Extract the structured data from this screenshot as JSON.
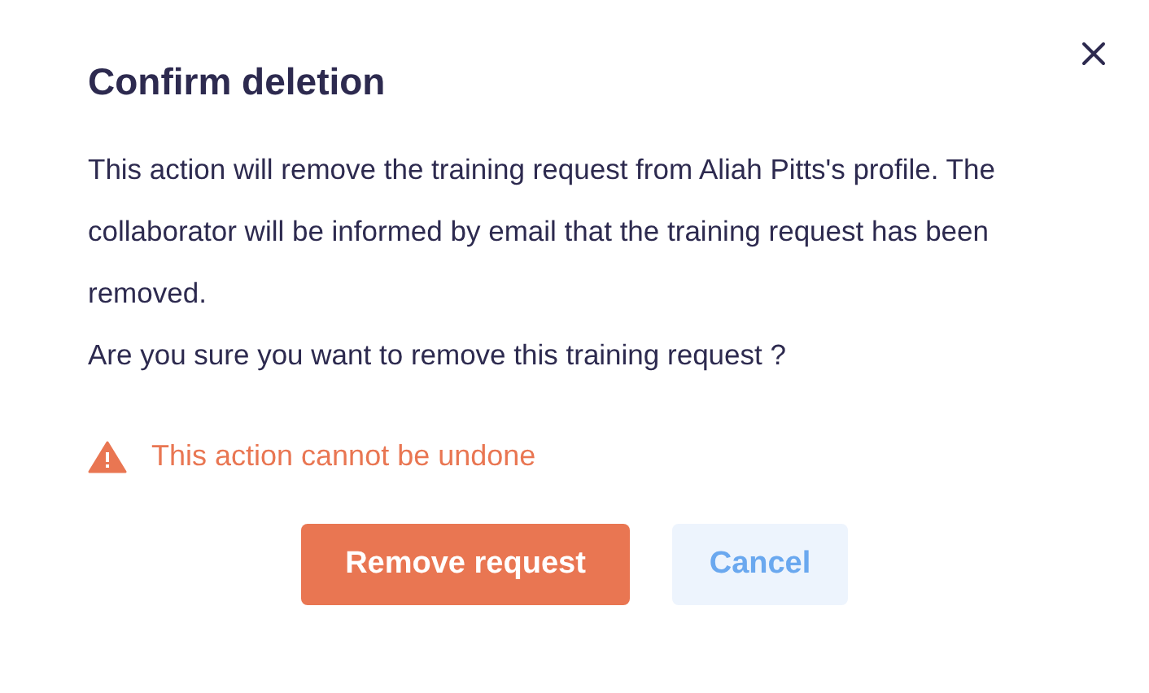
{
  "dialog": {
    "title": "Confirm deletion",
    "paragraphs": [
      "This action will remove the training request from Aliah Pitts's profile. The collaborator will be informed by email that the training request has been removed.",
      "Are you sure you want to remove this training request ?"
    ],
    "warning": "This action cannot be undone",
    "buttons": [
      {
        "label": "Remove request",
        "kind": "primary"
      },
      {
        "label": "Cancel",
        "kind": "secondary"
      }
    ]
  }
}
